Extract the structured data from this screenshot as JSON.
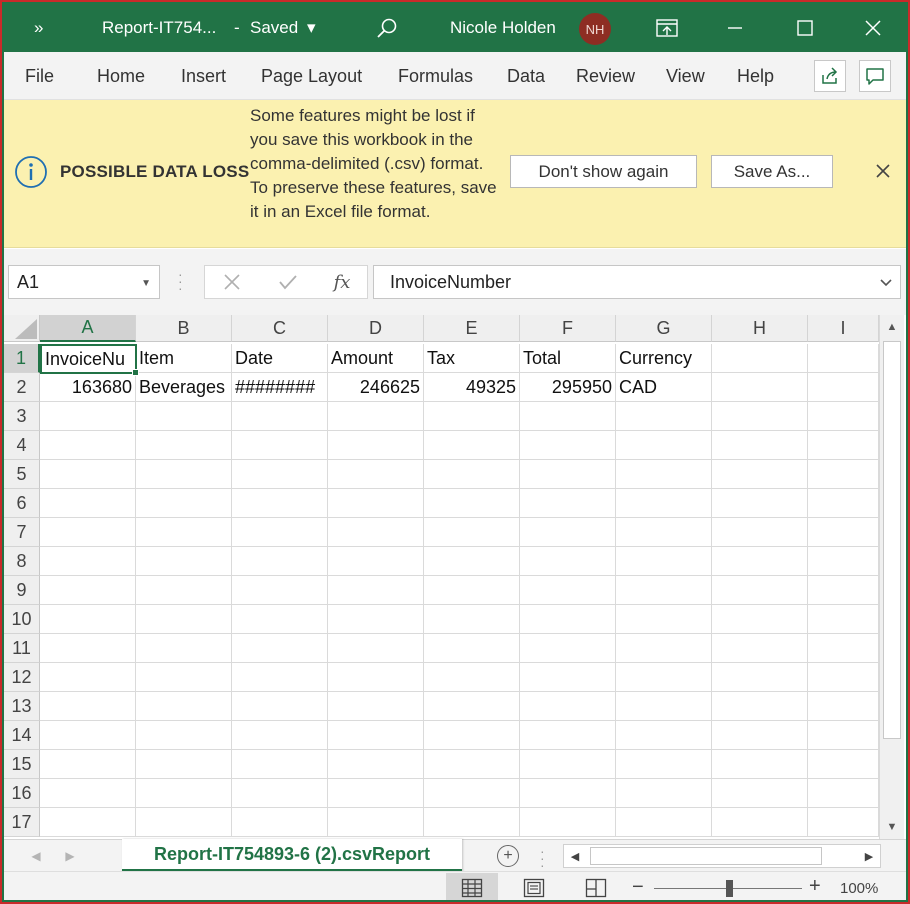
{
  "titlebar": {
    "qa_chevron": "»",
    "doc_title": "Report-IT754...",
    "separator": "-",
    "status": "Saved",
    "status_caret": "▾",
    "user_name": "Nicole Holden",
    "user_initials": "NH"
  },
  "menu": {
    "items": [
      "File",
      "Home",
      "Insert",
      "Page Layout",
      "Formulas",
      "Data",
      "Review",
      "View",
      "Help"
    ]
  },
  "message_bar": {
    "title": "POSSIBLE DATA LOSS",
    "text": "Some features might be lost if you save this workbook in the comma-delimited (.csv) format. To preserve these features, save it in an Excel file format.",
    "dont_show_label": "Don't show again",
    "save_as_label": "Save As...",
    "close_glyph": "×"
  },
  "formula_bar": {
    "name_box": "A1",
    "fx_label": "fx",
    "formula": "InvoiceNumber"
  },
  "grid": {
    "columns": [
      "A",
      "B",
      "C",
      "D",
      "E",
      "F",
      "G",
      "H",
      "I"
    ],
    "rows": [
      "1",
      "2",
      "3",
      "4",
      "5",
      "6",
      "7",
      "8",
      "9",
      "10",
      "11",
      "12",
      "13",
      "14",
      "15",
      "16",
      "17"
    ],
    "active_cell": "A1",
    "data": [
      [
        "InvoiceNu",
        "Item",
        "Date",
        "Amount",
        "Tax",
        "Total",
        "Currency"
      ],
      [
        "163680",
        "Beverages",
        "########",
        "246625",
        "49325",
        "295950",
        "CAD"
      ]
    ]
  },
  "sheets": {
    "tabs": [
      "Report-IT754893-6 (2).csvReport"
    ],
    "add_sheet": "+"
  },
  "statusbar": {
    "zoom_out": "−",
    "zoom_in": "+",
    "zoom_level": "100%",
    "zoom_value": 100
  },
  "colors": {
    "accent": "#217346",
    "message_bar": "#fbf1b0",
    "avatar": "#8e2d23",
    "outer_frame": "#c92a2a"
  },
  "icons": [
    "search-icon",
    "ribbon-display-icon",
    "minimize-icon",
    "maximize-icon",
    "close-icon",
    "share-icon",
    "comment-icon",
    "info-icon",
    "cancel-icon",
    "enter-icon",
    "normal-view-icon",
    "page-layout-view-icon",
    "page-break-preview-icon"
  ]
}
